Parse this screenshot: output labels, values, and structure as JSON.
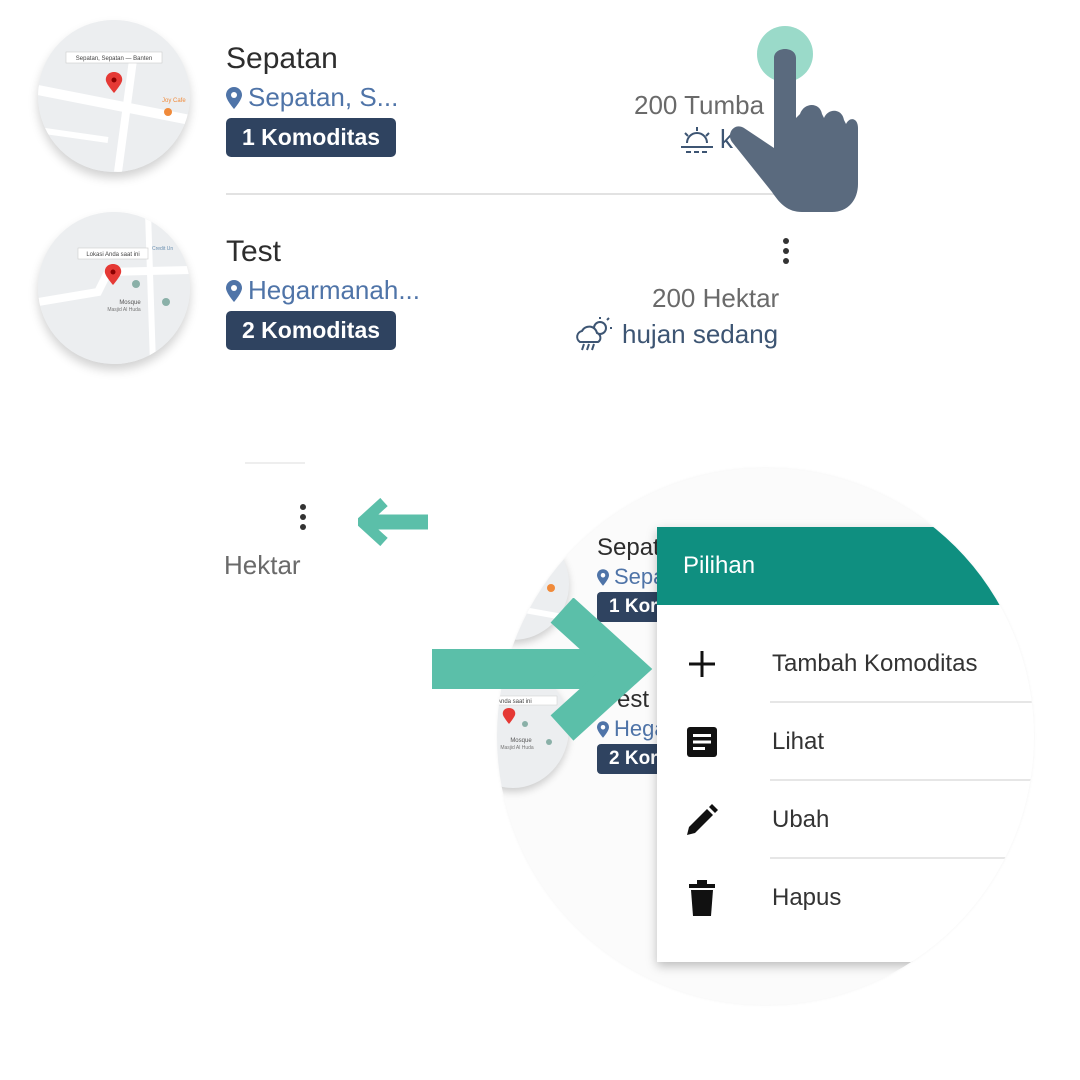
{
  "rows": [
    {
      "title": "Sepatan",
      "location": "Sepatan, S...",
      "badge": "1 Komoditas",
      "area": "200 Tumba",
      "weather": "ke",
      "map_label": "Sepatan, Sepatan — Banten",
      "map_place": "Joy Cafe"
    },
    {
      "title": "Test",
      "location": "Hegarmanah...",
      "badge": "2 Komoditas",
      "area": "200 Hektar",
      "weather": "hujan sedang",
      "map_label": "Lokasi Anda saat ini",
      "map_place": "Credit Un",
      "map_place2": "Mosque",
      "map_place2_sub": "Masjid Al Huda"
    }
  ],
  "partial_card": {
    "area": "Hektar"
  },
  "zoom": {
    "row1": {
      "title": "Sepat",
      "location": "Sepa",
      "badge": "1 Kor"
    },
    "row2": {
      "title": "est",
      "location": "Hega",
      "badge": "2 Kor",
      "map_label": "Anda saat ini",
      "map_place": "Mosque",
      "map_place_sub": "Masjid Al Huda"
    },
    "menu": {
      "title": "Pilihan",
      "items": [
        {
          "label": "Tambah Komoditas",
          "icon": "plus-icon"
        },
        {
          "label": "Lihat",
          "icon": "note-icon"
        },
        {
          "label": "Ubah",
          "icon": "pencil-icon"
        },
        {
          "label": "Hapus",
          "icon": "trash-icon"
        }
      ]
    }
  },
  "colors": {
    "accent": "#0f8f80",
    "badge": "#2f4360",
    "link": "#4f74a8",
    "arrow": "#5bbfa9",
    "hand": "#5a6a7e"
  }
}
